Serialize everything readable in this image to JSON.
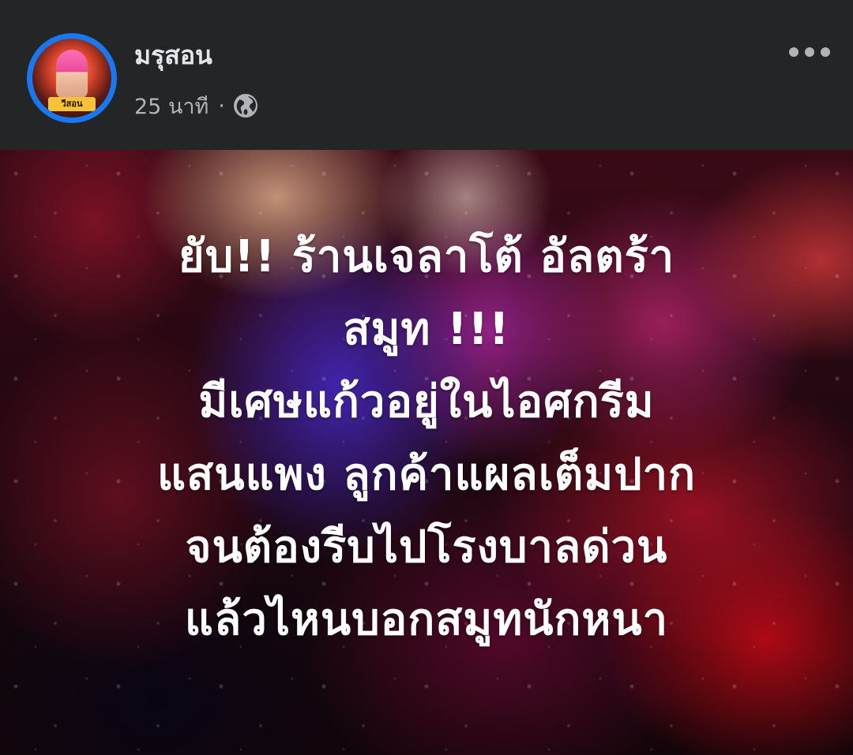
{
  "post": {
    "author_name": "มรุสอน",
    "timestamp": "25 นาที",
    "separator": "·",
    "privacy_icon": "globe-icon",
    "more_icon": "more-options-icon",
    "avatar_badge_text": "วีสอน",
    "accent_color": "#1877f2",
    "image_text_lines": [
      "ยับ!! ร้านเจลาโต้ อัลตร้า",
      "สมูท !!!",
      "มีเศษแก้วอยู่ในไอศกรีม",
      "แสนแพง ลูกค้าแผลเต็มปาก",
      "จนต้องรีบไปโรงบาลด่วน",
      "แล้วไหนบอกสมูทนักหนา"
    ]
  }
}
